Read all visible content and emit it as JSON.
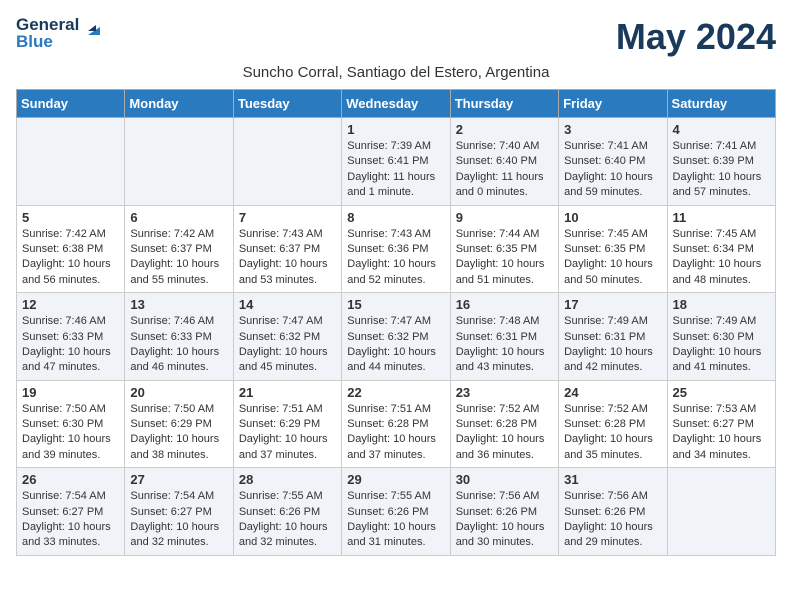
{
  "logo": {
    "general": "General",
    "blue": "Blue"
  },
  "title": "May 2024",
  "subtitle": "Suncho Corral, Santiago del Estero, Argentina",
  "days_of_week": [
    "Sunday",
    "Monday",
    "Tuesday",
    "Wednesday",
    "Thursday",
    "Friday",
    "Saturday"
  ],
  "weeks": [
    [
      {
        "day": "",
        "content": ""
      },
      {
        "day": "",
        "content": ""
      },
      {
        "day": "",
        "content": ""
      },
      {
        "day": "1",
        "content": "Sunrise: 7:39 AM\nSunset: 6:41 PM\nDaylight: 11 hours\nand 1 minute."
      },
      {
        "day": "2",
        "content": "Sunrise: 7:40 AM\nSunset: 6:40 PM\nDaylight: 11 hours\nand 0 minutes."
      },
      {
        "day": "3",
        "content": "Sunrise: 7:41 AM\nSunset: 6:40 PM\nDaylight: 10 hours\nand 59 minutes."
      },
      {
        "day": "4",
        "content": "Sunrise: 7:41 AM\nSunset: 6:39 PM\nDaylight: 10 hours\nand 57 minutes."
      }
    ],
    [
      {
        "day": "5",
        "content": "Sunrise: 7:42 AM\nSunset: 6:38 PM\nDaylight: 10 hours\nand 56 minutes."
      },
      {
        "day": "6",
        "content": "Sunrise: 7:42 AM\nSunset: 6:37 PM\nDaylight: 10 hours\nand 55 minutes."
      },
      {
        "day": "7",
        "content": "Sunrise: 7:43 AM\nSunset: 6:37 PM\nDaylight: 10 hours\nand 53 minutes."
      },
      {
        "day": "8",
        "content": "Sunrise: 7:43 AM\nSunset: 6:36 PM\nDaylight: 10 hours\nand 52 minutes."
      },
      {
        "day": "9",
        "content": "Sunrise: 7:44 AM\nSunset: 6:35 PM\nDaylight: 10 hours\nand 51 minutes."
      },
      {
        "day": "10",
        "content": "Sunrise: 7:45 AM\nSunset: 6:35 PM\nDaylight: 10 hours\nand 50 minutes."
      },
      {
        "day": "11",
        "content": "Sunrise: 7:45 AM\nSunset: 6:34 PM\nDaylight: 10 hours\nand 48 minutes."
      }
    ],
    [
      {
        "day": "12",
        "content": "Sunrise: 7:46 AM\nSunset: 6:33 PM\nDaylight: 10 hours\nand 47 minutes."
      },
      {
        "day": "13",
        "content": "Sunrise: 7:46 AM\nSunset: 6:33 PM\nDaylight: 10 hours\nand 46 minutes."
      },
      {
        "day": "14",
        "content": "Sunrise: 7:47 AM\nSunset: 6:32 PM\nDaylight: 10 hours\nand 45 minutes."
      },
      {
        "day": "15",
        "content": "Sunrise: 7:47 AM\nSunset: 6:32 PM\nDaylight: 10 hours\nand 44 minutes."
      },
      {
        "day": "16",
        "content": "Sunrise: 7:48 AM\nSunset: 6:31 PM\nDaylight: 10 hours\nand 43 minutes."
      },
      {
        "day": "17",
        "content": "Sunrise: 7:49 AM\nSunset: 6:31 PM\nDaylight: 10 hours\nand 42 minutes."
      },
      {
        "day": "18",
        "content": "Sunrise: 7:49 AM\nSunset: 6:30 PM\nDaylight: 10 hours\nand 41 minutes."
      }
    ],
    [
      {
        "day": "19",
        "content": "Sunrise: 7:50 AM\nSunset: 6:30 PM\nDaylight: 10 hours\nand 39 minutes."
      },
      {
        "day": "20",
        "content": "Sunrise: 7:50 AM\nSunset: 6:29 PM\nDaylight: 10 hours\nand 38 minutes."
      },
      {
        "day": "21",
        "content": "Sunrise: 7:51 AM\nSunset: 6:29 PM\nDaylight: 10 hours\nand 37 minutes."
      },
      {
        "day": "22",
        "content": "Sunrise: 7:51 AM\nSunset: 6:28 PM\nDaylight: 10 hours\nand 37 minutes."
      },
      {
        "day": "23",
        "content": "Sunrise: 7:52 AM\nSunset: 6:28 PM\nDaylight: 10 hours\nand 36 minutes."
      },
      {
        "day": "24",
        "content": "Sunrise: 7:52 AM\nSunset: 6:28 PM\nDaylight: 10 hours\nand 35 minutes."
      },
      {
        "day": "25",
        "content": "Sunrise: 7:53 AM\nSunset: 6:27 PM\nDaylight: 10 hours\nand 34 minutes."
      }
    ],
    [
      {
        "day": "26",
        "content": "Sunrise: 7:54 AM\nSunset: 6:27 PM\nDaylight: 10 hours\nand 33 minutes."
      },
      {
        "day": "27",
        "content": "Sunrise: 7:54 AM\nSunset: 6:27 PM\nDaylight: 10 hours\nand 32 minutes."
      },
      {
        "day": "28",
        "content": "Sunrise: 7:55 AM\nSunset: 6:26 PM\nDaylight: 10 hours\nand 32 minutes."
      },
      {
        "day": "29",
        "content": "Sunrise: 7:55 AM\nSunset: 6:26 PM\nDaylight: 10 hours\nand 31 minutes."
      },
      {
        "day": "30",
        "content": "Sunrise: 7:56 AM\nSunset: 6:26 PM\nDaylight: 10 hours\nand 30 minutes."
      },
      {
        "day": "31",
        "content": "Sunrise: 7:56 AM\nSunset: 6:26 PM\nDaylight: 10 hours\nand 29 minutes."
      },
      {
        "day": "",
        "content": ""
      }
    ]
  ]
}
